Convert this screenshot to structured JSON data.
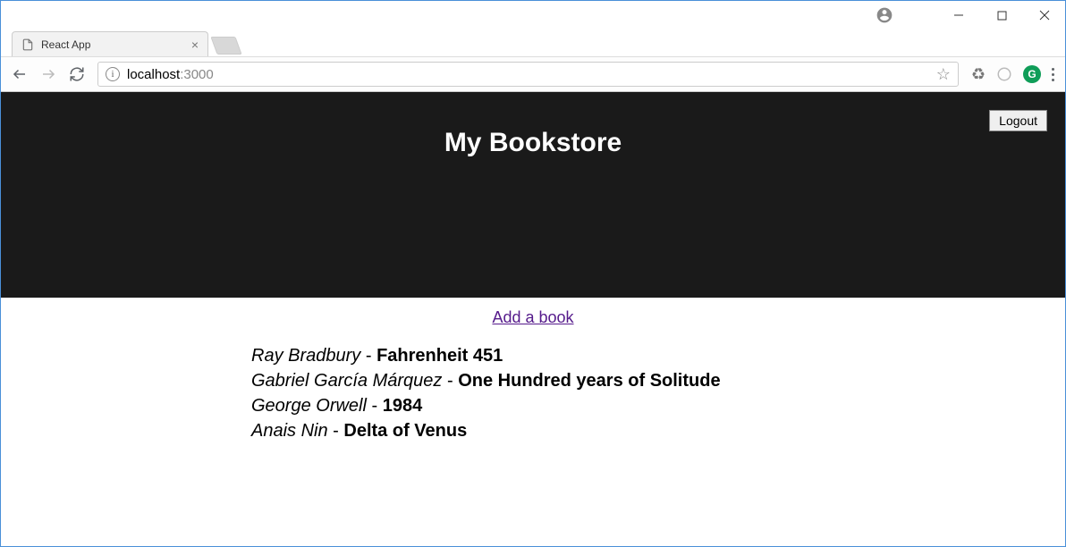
{
  "window": {
    "minimize": "—",
    "maximize": "▢",
    "close": "✕"
  },
  "browser": {
    "tab_title": "React App",
    "tab_close": "×",
    "url_host": "localhost",
    "url_port": ":3000",
    "info_symbol": "i",
    "star_symbol": "☆",
    "recycle_symbol": "♻",
    "g_symbol": "G"
  },
  "app": {
    "hero_title": "My Bookstore",
    "logout_label": "Logout",
    "add_link": "Add a book",
    "separator": " - ",
    "books": [
      {
        "author": "Ray Bradbury",
        "title": "Fahrenheit 451"
      },
      {
        "author": "Gabriel García Márquez",
        "title": "One Hundred years of Solitude"
      },
      {
        "author": "George Orwell",
        "title": "1984"
      },
      {
        "author": "Anais Nin",
        "title": "Delta of Venus"
      }
    ]
  }
}
